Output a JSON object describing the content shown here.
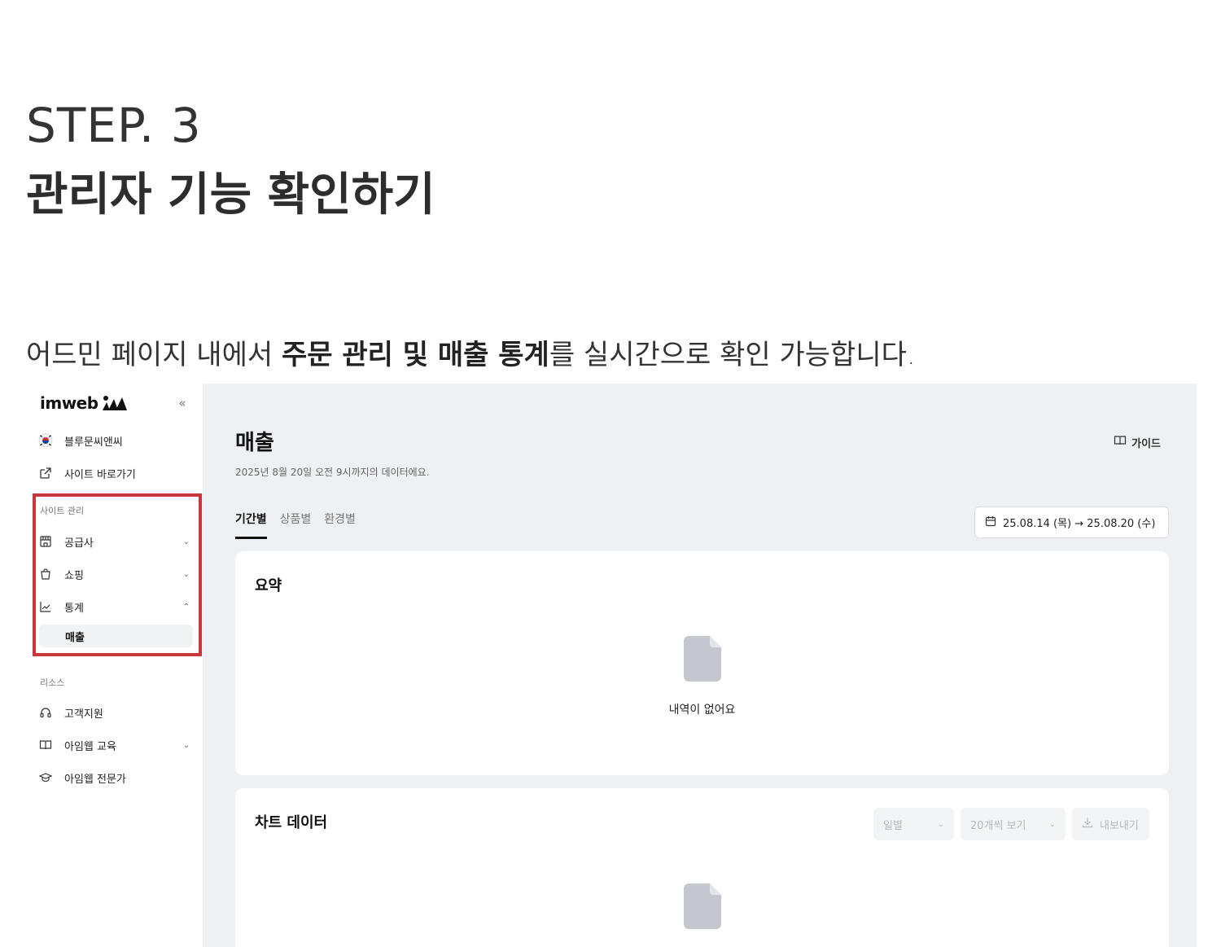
{
  "hero": {
    "step": "STEP. 3",
    "title": "관리자 기능 확인하기"
  },
  "description": {
    "before": "어드민 페이지 내에서 ",
    "bold": "주문 관리 및 매출 통계",
    "after": "를 실시간으로 확인 가능합니다."
  },
  "sidebar": {
    "logo": "imweb",
    "collapse": "«",
    "site_name": "블루문씨앤씨",
    "goto_site": "사이트 바로가기",
    "section_site": "사이트 관리",
    "items": [
      {
        "label": "공급사",
        "icon": "store-icon"
      },
      {
        "label": "쇼핑",
        "icon": "shopping-bag-icon"
      },
      {
        "label": "통계",
        "icon": "chart-icon"
      }
    ],
    "sub_item": "매출",
    "section_resources": "리소스",
    "resources": [
      {
        "label": "고객지원",
        "icon": "headset-icon"
      },
      {
        "label": "아임웹 교육",
        "icon": "book-icon"
      },
      {
        "label": "아임웹 전문가",
        "icon": "graduation-cap-icon"
      }
    ]
  },
  "main": {
    "title": "매출",
    "subtitle": "2025년 8월 20일 오전 9시까지의 데이터에요.",
    "guide": "가이드",
    "tabs": [
      "기간별",
      "상품별",
      "환경별"
    ],
    "date_range": "25.08.14 (목) → 25.08.20 (수)",
    "summary_title": "요약",
    "empty_text": "내역이 없어요",
    "chart_title": "차트 데이터",
    "chart_controls": {
      "period": "일별",
      "page_size": "20개씩 보기",
      "export": "내보내기"
    }
  },
  "colors": {
    "highlight": "#c8363c",
    "main_bg": "#eff0f3"
  }
}
